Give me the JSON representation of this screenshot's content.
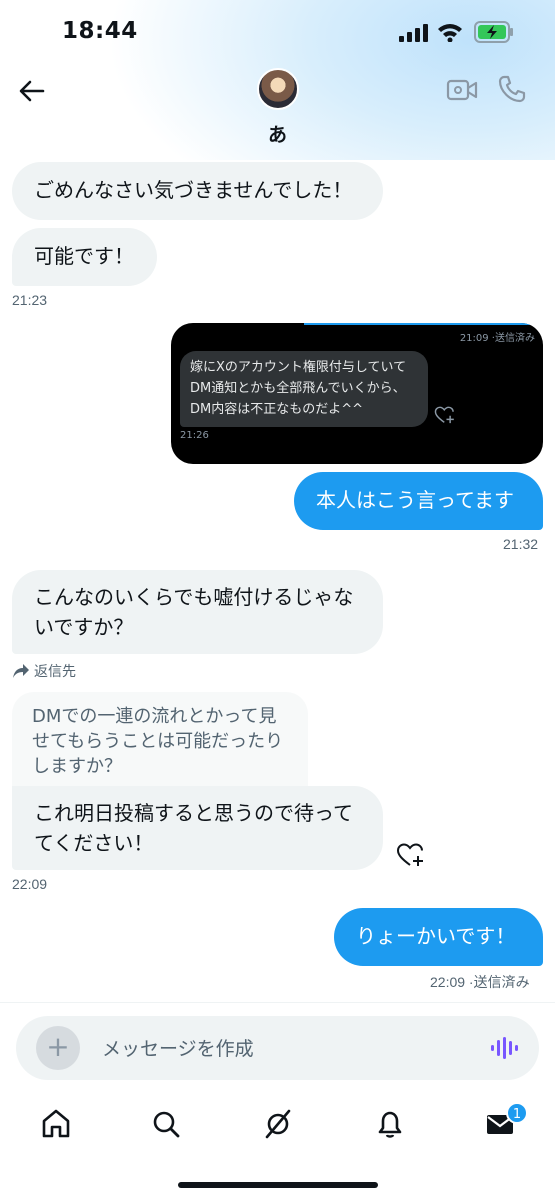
{
  "status_bar": {
    "time": "18:44"
  },
  "header": {
    "contact_name": "あ"
  },
  "messages": [
    {
      "text": "ごめんなさい気づきませんでした！"
    },
    {
      "text": "可能です！"
    },
    {
      "text": "本人はこう言ってます"
    },
    {
      "text": "こんなのいくらでも嘘付けるじゃないですか？"
    },
    {
      "text": "これ明日投稿すると思うので待っててください！"
    },
    {
      "text": "りょーかいです！"
    }
  ],
  "timestamps": {
    "t1": "21:23",
    "t3": "21:32",
    "t5": "22:09",
    "t6": "22:09 ·送信済み"
  },
  "image_message": {
    "top_status": "21:09 ·送信済み",
    "text": "嫁にXのアカウント権限付与していてDM通知とかも全部飛んでいくから、DM内容は不正なものだよ^^",
    "time": "21:26"
  },
  "reply": {
    "label": "返信先",
    "quoted_text": "DMでの一連の流れとかって見せてもらうことは可能だったりしますか？"
  },
  "composer": {
    "placeholder": "メッセージを作成",
    "add": "+"
  },
  "nav": {
    "messages_badge": "1"
  },
  "colors": {
    "accent": "#1d9bf0",
    "incoming_bubble": "#eff3f4",
    "voice": "#7856ff"
  },
  "icons": [
    "back-icon",
    "video-call-icon",
    "phone-icon",
    "heart-plus-icon",
    "reply-arrow-icon",
    "voice-icon",
    "home-icon",
    "search-icon",
    "grok-icon",
    "bell-icon",
    "mail-icon"
  ]
}
